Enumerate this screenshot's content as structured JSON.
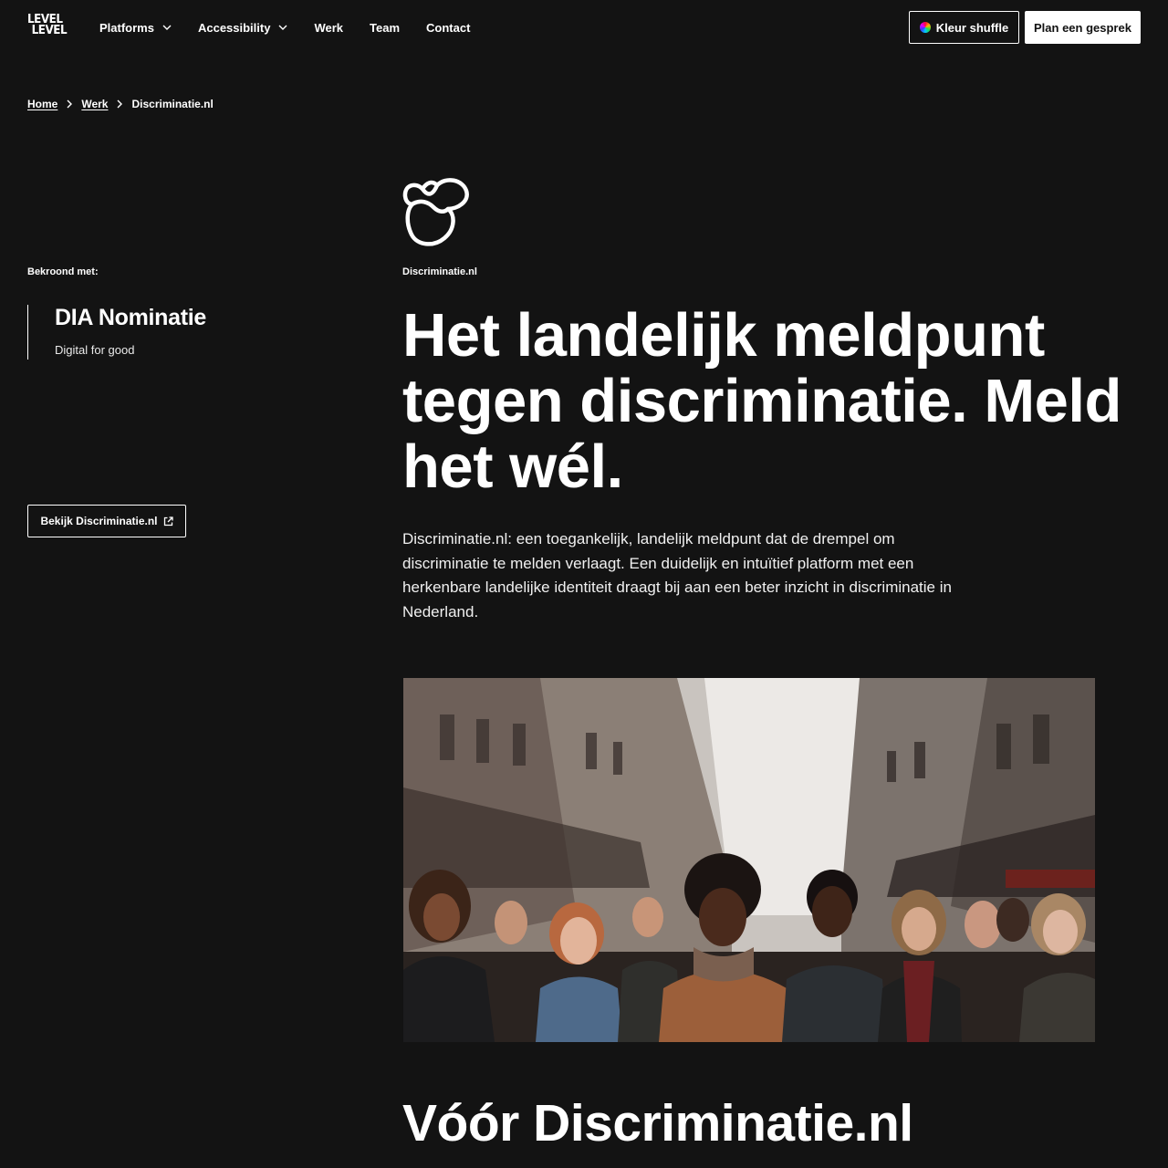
{
  "header": {
    "logo_line1": "LEVEL",
    "logo_line2": "LEVEL",
    "nav": [
      {
        "label": "Platforms",
        "has_dropdown": true
      },
      {
        "label": "Accessibility",
        "has_dropdown": true
      },
      {
        "label": "Werk",
        "has_dropdown": false
      },
      {
        "label": "Team",
        "has_dropdown": false
      },
      {
        "label": "Contact",
        "has_dropdown": false
      }
    ],
    "shuffle_label": "Kleur shuffle",
    "plan_label": "Plan een gesprek"
  },
  "breadcrumb": {
    "items": [
      "Home",
      "Werk"
    ],
    "current": "Discriminatie.nl"
  },
  "award": {
    "label": "Bekroond met:",
    "title": "DIA Nominatie",
    "subtitle": "Digital for good"
  },
  "view_button_label": "Bekijk Discriminatie.nl",
  "project": {
    "name": "Discriminatie.nl",
    "headline": "Het landelijk meldpunt tegen discriminatie. Meld het wél.",
    "intro": "Discriminatie.nl: een toegankelijk, landelijk meldpunt dat de drempel om discriminatie te melden verlaagt. Een duidelijk en intuïtief platform met een herkenbare landelijke identiteit draagt bij aan een beter inzicht in discriminatie in Nederland."
  },
  "section": {
    "heading": "Vóór Discriminatie.nl"
  },
  "colors": {
    "background": "#131313",
    "text": "#ffffff",
    "button_fill": "#ffffff"
  },
  "icons": [
    "chevron-down-icon",
    "chevron-right-icon",
    "external-link-icon",
    "color-wheel-icon",
    "discriminatie-logo-icon"
  ]
}
